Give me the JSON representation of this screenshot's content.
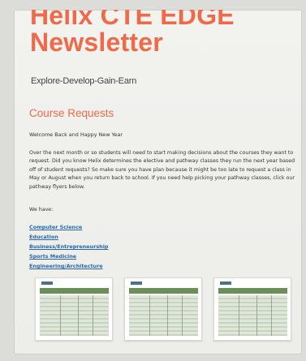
{
  "newsletter": {
    "title_line1": "Helix CTE EDGE",
    "title_line2": "Newsletter",
    "tagline": "Explore-Develop-Gain-Earn"
  },
  "section": {
    "title": "Course Requests",
    "greeting": "Welcome Back and Happy New Year",
    "paragraph": "Over the next month or so students will need to start making decisions about the courses they want to request. Did you know Helix determines the elective and pathway classes they run the next year based off of student requests? So make sure you have plan because it might be too late to request a class in May or August when you return back to school. If you need help picking your pathway classes, click our pathway flyers below.",
    "we_have": "We have:",
    "links": [
      "Computer Science",
      "Education",
      "Business/Entrepreneurship",
      "Sports Medicine",
      "Engineering/Architecture"
    ]
  },
  "colors": {
    "accent": "#ef6a4a",
    "link": "#2a67a8",
    "flyer_band": "#6b8f5b"
  }
}
